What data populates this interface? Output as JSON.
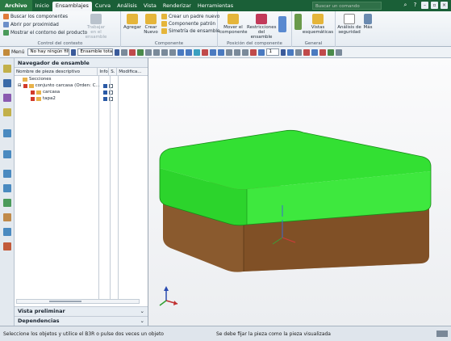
{
  "menubar": {
    "tabs": [
      "Archivo",
      "Inicio",
      "Ensamblajes",
      "Curva",
      "Análisis",
      "Vista",
      "Renderizar",
      "Herramientas"
    ],
    "active_tab": "Ensamblajes",
    "search_placeholder": "Buscar un comando"
  },
  "ribbon": {
    "contexto": {
      "items": [
        "Buscar los componentes",
        "Abrir por proximidad",
        "Mostrar el contorno del producto"
      ],
      "big_button": "Trabajar en el ensamble",
      "label": "Control del contexto"
    },
    "componente": {
      "agregar": "Agregar",
      "crear_nuevo": "Crear Nuevo",
      "items": [
        "Crear un padre nuevo",
        "Componente patrón",
        "Simetría de ensamble"
      ],
      "label": "Componente"
    },
    "posicion": {
      "mover": "Mover el componente",
      "restricciones": "Restricciones del ensamble",
      "label": "Posición del componente"
    },
    "general": {
      "vistas": "Vistas esquemáticas",
      "label": "General"
    },
    "analisis": {
      "seguridad": "Análisis de seguridad",
      "mas": "Más"
    }
  },
  "toolbar": {
    "menu_label": "Menú",
    "filter": "No hay ningún filtro",
    "scope": "Ensamble total",
    "number": "1"
  },
  "navigator": {
    "title": "Navegador de ensamble",
    "columns": [
      "Nombre de pieza descriptivo",
      "Info",
      "S.",
      "Modifica..."
    ],
    "rows": [
      {
        "label": "Secciones",
        "indent": 0
      },
      {
        "label": "conjunto carcasa (Orden: C...",
        "indent": 1
      },
      {
        "label": "carcasa",
        "indent": 2
      },
      {
        "label": "tapa2",
        "indent": 2
      }
    ],
    "panes": [
      "Vista preliminar",
      "Dependencias"
    ]
  },
  "status": {
    "left": "Seleccione los objetos y utilice el B3R o pulse dos veces un objeto",
    "center": "Se debe fijar la pieza como la pieza visualizada"
  },
  "colors": {
    "lid": "#2fe02f",
    "body": "#8a5a2e",
    "menubar": "#1a5f37"
  }
}
